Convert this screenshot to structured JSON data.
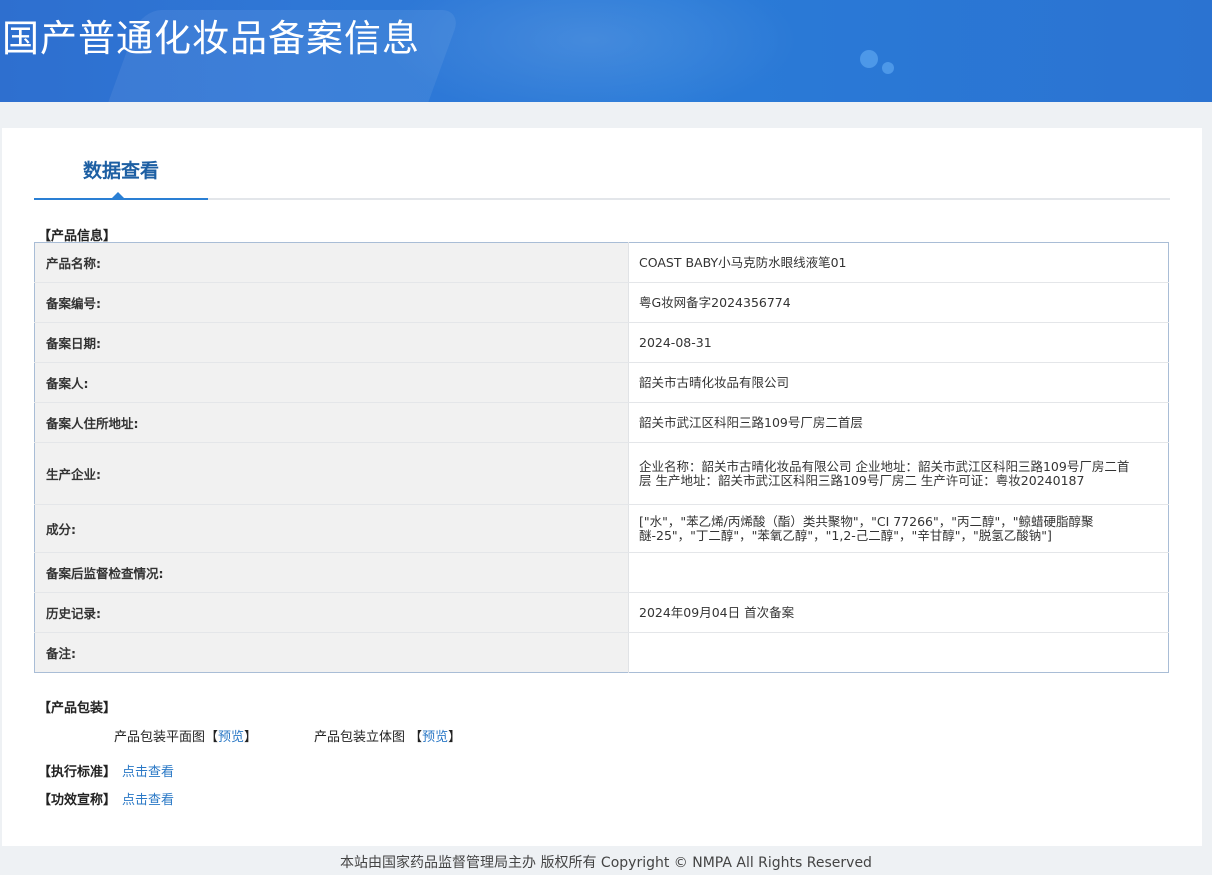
{
  "header": {
    "title": "国产普通化妆品备案信息"
  },
  "tabs": [
    {
      "label": "数据查看",
      "active": true
    }
  ],
  "product_info": {
    "section_label": "【产品信息】",
    "rows": [
      {
        "key": "产品名称:",
        "value": "COAST BABY小马克防水眼线液笔01"
      },
      {
        "key": "备案编号:",
        "value": "粤G妆网备字2024356774"
      },
      {
        "key": "备案日期:",
        "value": "2024-08-31"
      },
      {
        "key": "备案人:",
        "value": "韶关市古晴化妆品有限公司"
      },
      {
        "key": "备案人住所地址:",
        "value": "韶关市武江区科阳三路109号厂房二首层"
      },
      {
        "key": "生产企业:",
        "value": "企业名称：韶关市古晴化妆品有限公司 企业地址：韶关市武江区科阳三路109号厂房二首层 生产地址：韶关市武江区科阳三路109号厂房二 生产许可证：粤妆20240187"
      },
      {
        "key": "成分:",
        "value": "[\"水\"，\"苯乙烯/丙烯酸（酯）类共聚物\"，\"CI 77266\"，\"丙二醇\"，\"鲸蜡硬脂醇聚醚-25\"，\"丁二醇\"，\"苯氧乙醇\"，\"1,2-己二醇\"，\"辛甘醇\"，\"脱氢乙酸钠\"]"
      },
      {
        "key": "备案后监督检查情况:",
        "value": ""
      },
      {
        "key": "历史记录:",
        "value": "2024年09月04日 首次备案"
      },
      {
        "key": "备注:",
        "value": ""
      }
    ]
  },
  "packaging": {
    "section_label": "【产品包装】",
    "flat_label": "产品包装平面图",
    "flat_bracket_open": "【",
    "flat_link": "预览",
    "flat_bracket_close": "】",
    "stereo_label": "产品包装立体图 ",
    "stereo_bracket_open": "【",
    "stereo_link": "预览",
    "stereo_bracket_close": "】"
  },
  "standard": {
    "label": "【执行标准】",
    "link": "点击查看"
  },
  "efficacy": {
    "label": "【功效宣称】",
    "link": "点击查看"
  },
  "footer": {
    "text": "本站由国家药品监督管理局主办 版权所有 Copyright © NMPA All Rights Reserved"
  }
}
